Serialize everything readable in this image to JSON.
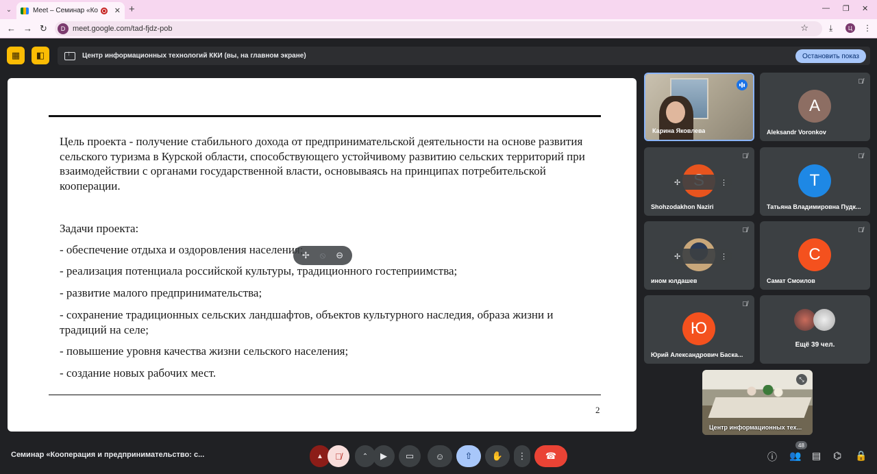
{
  "browser": {
    "tab_title": "Meet – Семинар «Коопера",
    "tab_close": "✕",
    "new_tab": "+",
    "url": "meet.google.com/tad-fjdz-pob",
    "profile_initial": "Ц",
    "site_initial": "D"
  },
  "meet": {
    "presenting_text": "Центр информационных технологий ККИ (вы, на главном экране)",
    "stop_presenting": "Остановить показ",
    "meeting_title": "Семинар «Кооперация и предпринимательство: с...",
    "people_count": "48"
  },
  "slide": {
    "goal": "Цель проекта - получение стабильного дохода от предпринимательской деятельности на основе развития сельского туризма в Курской области, способствующего устойчивому развитию сельских территорий при взаимодействии с органами государственной власти, основываясь на принципах потребительской кооперации.",
    "tasks_title": "Задачи проекта:",
    "tasks": [
      "- обеспечение отдыха и оздоровления населения;",
      "- реализация потенциала российской культуры, традиционного гостеприимства;",
      "- развитие малого предпринимательства;",
      "- сохранение традиционных сельских ландшафтов, объектов культурного наследия, образа жизни и традиций на селе;",
      "- повышение уровня качества жизни сельского населения;",
      "- создание новых рабочих мест."
    ],
    "page_number": "2"
  },
  "participants": [
    {
      "name": "Карина Яковлева",
      "type": "video",
      "speaking": true
    },
    {
      "name": "Aleksandr Voronkov",
      "initial": "A",
      "color": "#8d6e63"
    },
    {
      "name": "Shohzodakhon Naziri",
      "initial": "S",
      "color": "#e8541e"
    },
    {
      "name": "Татьяна Владимировна Пудк...",
      "initial": "Т",
      "color": "#1e88e5"
    },
    {
      "name": "ином юлдашев",
      "type": "photo"
    },
    {
      "name": "Самат Смоилов",
      "initial": "С",
      "color": "#f4511e"
    },
    {
      "name": "Юрий Александрович Баска...",
      "initial": "Ю",
      "color": "#f4511e"
    },
    {
      "name": "Ещё 39 чел.",
      "type": "more"
    }
  ],
  "self_view": {
    "name": "Центр информационных тех..."
  },
  "colors": {
    "accent": "#a8c7fa",
    "end_call": "#ea4335",
    "yellow": "#fbbc04"
  }
}
